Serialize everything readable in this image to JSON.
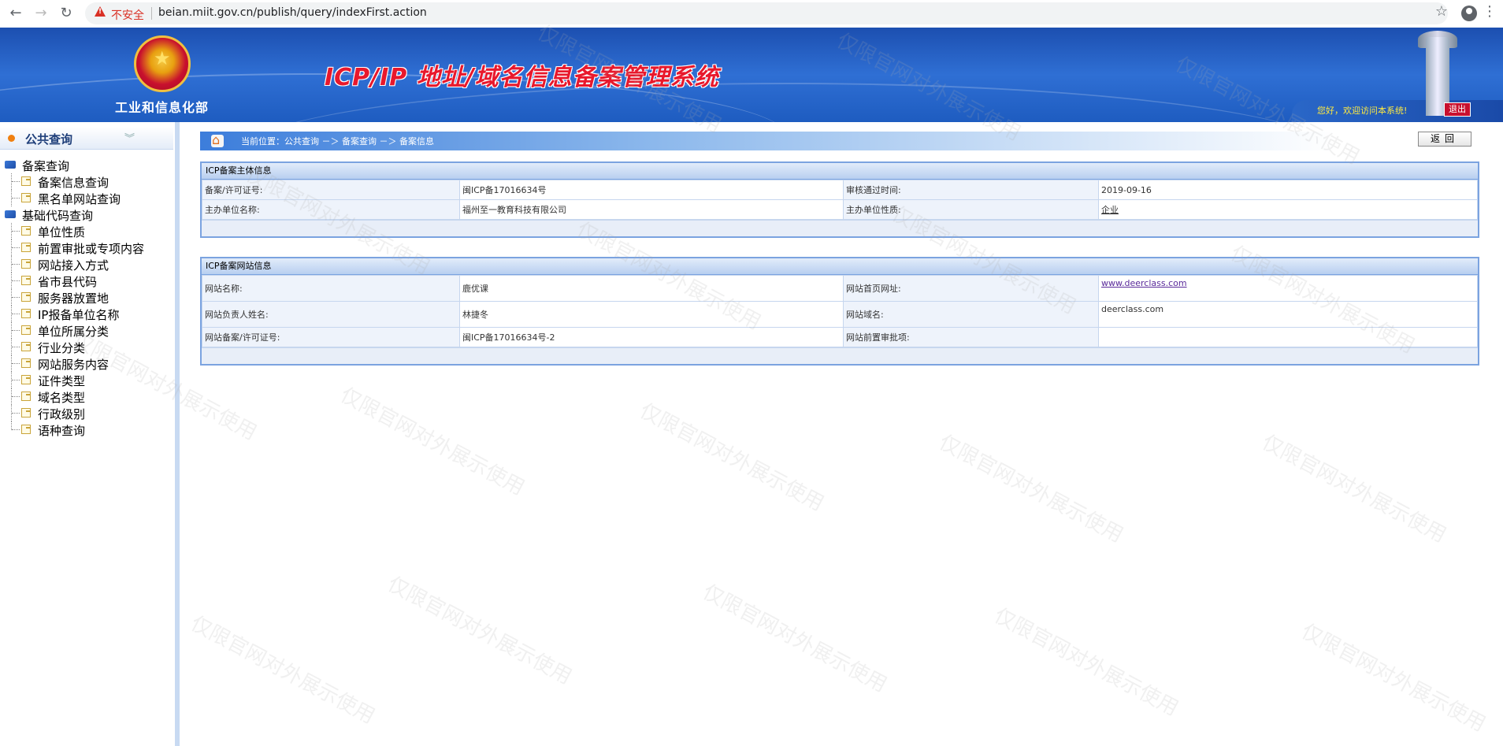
{
  "browser": {
    "insecure_label": "不安全",
    "url": "beian.miit.gov.cn/publish/query/indexFirst.action"
  },
  "header": {
    "ministry": "工业和信息化部",
    "system_title": "ICP/IP 地址/域名信息备案管理系统",
    "welcome": "您好，欢迎访问本系统!",
    "logout": "退出"
  },
  "sidebar": {
    "title": "公共查询",
    "groups": [
      {
        "label": "备案查询",
        "items": [
          "备案信息查询",
          "黑名单网站查询"
        ]
      },
      {
        "label": "基础代码查询",
        "items": [
          "单位性质",
          "前置审批或专项内容",
          "网站接入方式",
          "省市县代码",
          "服务器放置地",
          "IP报备单位名称",
          "单位所属分类",
          "行业分类",
          "网站服务内容",
          "证件类型",
          "域名类型",
          "行政级别",
          "语种查询"
        ]
      }
    ]
  },
  "breadcrumb": {
    "text": "当前位置：公共查询  －＞  备案查询  －＞  备案信息"
  },
  "back_button": "返回",
  "subject_panel": {
    "title": "ICP备案主体信息",
    "license_label": "备案/许可证号:",
    "license_value": "闽ICP备17016634号",
    "approve_label": "审核通过时间:",
    "approve_value": "2019-09-16",
    "org_label": "主办单位名称:",
    "org_value": "福州至一教育科技有限公司",
    "nature_label": "主办单位性质:",
    "nature_value": "企业"
  },
  "site_panel": {
    "title": "ICP备案网站信息",
    "name_label": "网站名称:",
    "name_value": "鹿优课",
    "homepage_label": "网站首页网址:",
    "homepage_value": "www.deerclass.com",
    "owner_label": "网站负责人姓名:",
    "owner_value": "林捷冬",
    "domain_label": "网站域名:",
    "domain_value": "deerclass.com",
    "site_license_label": "网站备案/许可证号:",
    "site_license_value": "闽ICP备17016634号-2",
    "preapproval_label": "网站前置审批项:",
    "preapproval_value": ""
  },
  "watermark": "仅限官网对外展示使用"
}
